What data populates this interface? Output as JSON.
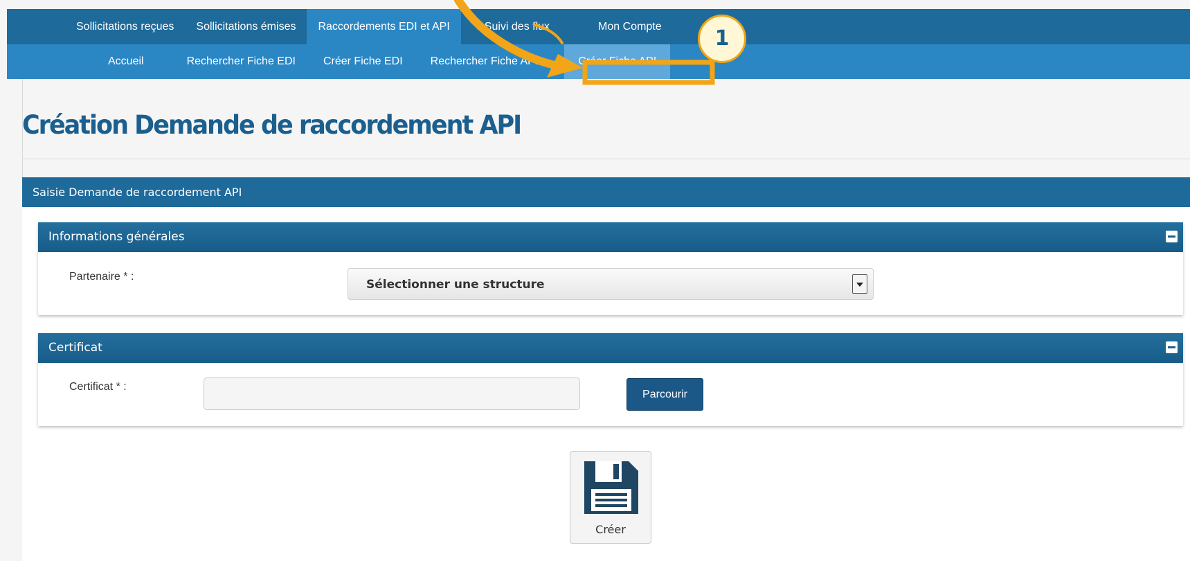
{
  "top_nav": {
    "items": [
      {
        "label": "Sollicitations reçues"
      },
      {
        "label": "Sollicitations émises"
      },
      {
        "label": "Raccordements EDI et API"
      },
      {
        "label": "Suivi des flux"
      },
      {
        "label": "Mon Compte"
      }
    ]
  },
  "sub_nav": {
    "items": [
      {
        "label": "Accueil"
      },
      {
        "label": "Rechercher Fiche EDI"
      },
      {
        "label": "Créer Fiche EDI"
      },
      {
        "label": "Rechercher Fiche API"
      },
      {
        "label": "Créer Fiche API"
      }
    ]
  },
  "page": {
    "title": "Création Demande de raccordement API"
  },
  "panel": {
    "title": "Saisie Demande de raccordement API"
  },
  "general_info": {
    "title": "Informations générales",
    "partner_label": "Partenaire * :",
    "partner_select_value": "Sélectionner une structure"
  },
  "certificate": {
    "title": "Certificat",
    "label": "Certificat * :",
    "browse_label": "Parcourir"
  },
  "actions": {
    "create_label": "Créer"
  },
  "annotation": {
    "step_number": "1",
    "color": "#f2a516"
  },
  "colors": {
    "nav_dark": "#1e6a9b",
    "nav_light": "#2b87c4",
    "title": "#1b5f8f"
  }
}
